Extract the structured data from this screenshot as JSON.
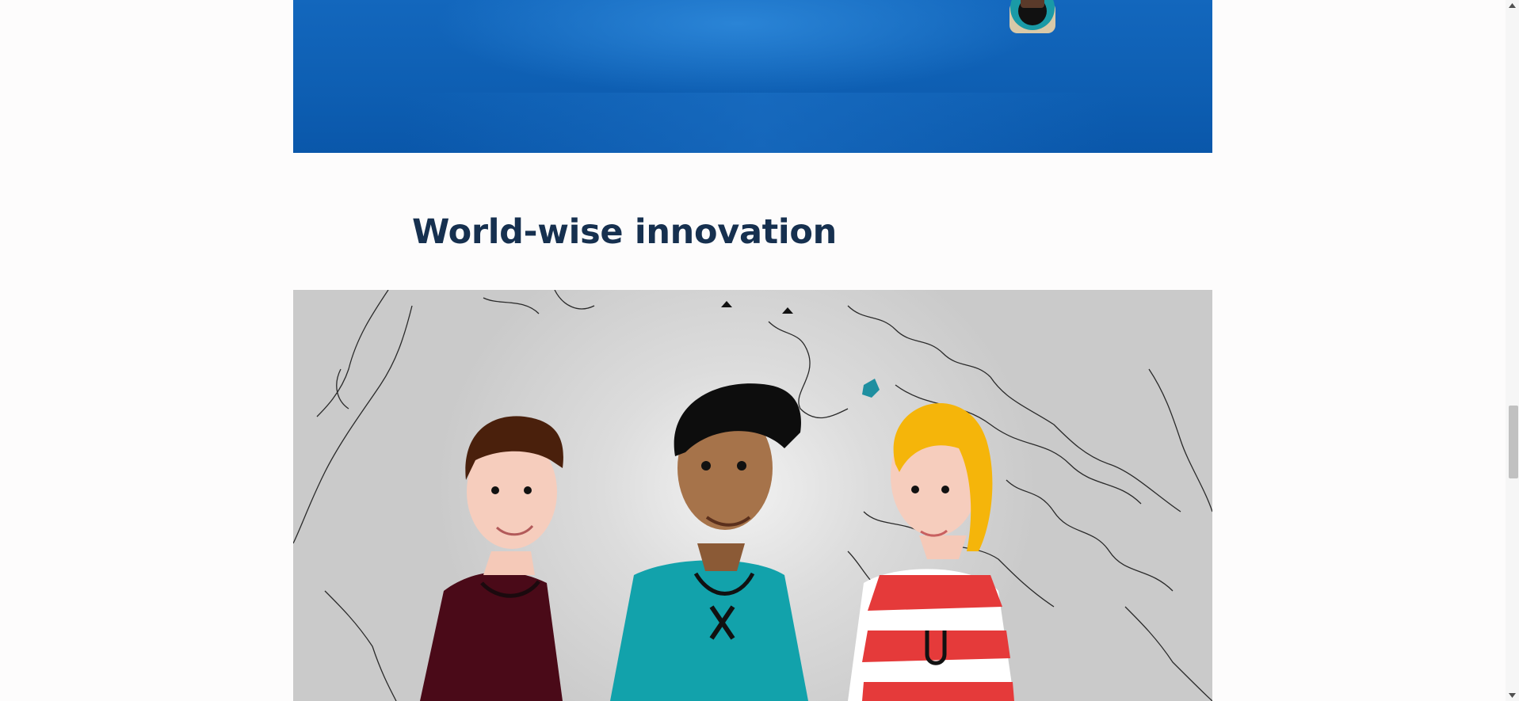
{
  "section": {
    "title": "World-wise innovation"
  },
  "icons": {
    "hero_avatar": "person-avatar-icon",
    "scroll_up": "chevron-up-icon",
    "scroll_down": "chevron-down-icon"
  },
  "colors": {
    "hero_blue": "#0e5fb3",
    "title": "#16304f",
    "illustration_bg": "#cacaca",
    "teal": "#0f9aa6"
  },
  "scrollbar": {
    "position_fraction": 0.62
  }
}
